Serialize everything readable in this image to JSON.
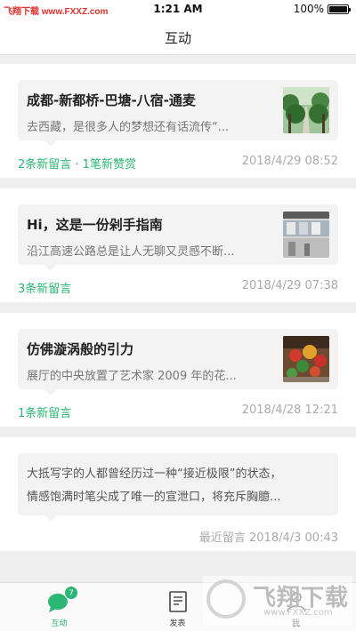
{
  "status_bar": {
    "watermark": "飞翔下载 www.FXXZ.com",
    "time": "1:21 AM",
    "battery": "100%"
  },
  "nav": {
    "title": "互动"
  },
  "feed": {
    "items": [
      {
        "title": "成都-新都桥-巴塘-八宿-通麦",
        "excerpt": "去西藏，是很多人的梦想还有话流传“...",
        "meta": "2条新留言 · 1笔新赞赏",
        "date": "2018/4/29  08:52",
        "thumb_icon": "trees-road-thumbnail"
      },
      {
        "title": "Hi，这是一份剁手指南",
        "excerpt": "沿江高速公路总是让人无聊又灵感不断...",
        "meta": "3条新留言",
        "date": "2018/4/29  07:38",
        "thumb_icon": "gallery-thumbnail"
      },
      {
        "title": "仿佛漩涡般的引力",
        "excerpt": "展厅的中央放置了艺术家 2009 年的花...",
        "meta": "1条新留言",
        "date": "2018/4/28  12:21",
        "thumb_icon": "flower-sculpture-thumbnail"
      }
    ],
    "text_item": {
      "line1": "大抵写字的人都曾经历过一种“接近极限”的状态，",
      "line2": "情感饱满时笔尖成了唯一的宣泄口，将充斥胸臆...",
      "date": "最近留言 2018/4/3  00:43"
    }
  },
  "tabs": [
    {
      "label": "互动",
      "badge": "7",
      "icon": "chat-bubble-icon"
    },
    {
      "label": "发表",
      "icon": "compose-icon"
    },
    {
      "label": "我",
      "icon": "person-icon"
    }
  ],
  "watermark_logo": {
    "main": "飞翔下载",
    "sub": "www.FXXZ.com"
  },
  "colors": {
    "accent": "#2bb673",
    "background": "#efefef",
    "bubble": "#f3f3f3"
  }
}
